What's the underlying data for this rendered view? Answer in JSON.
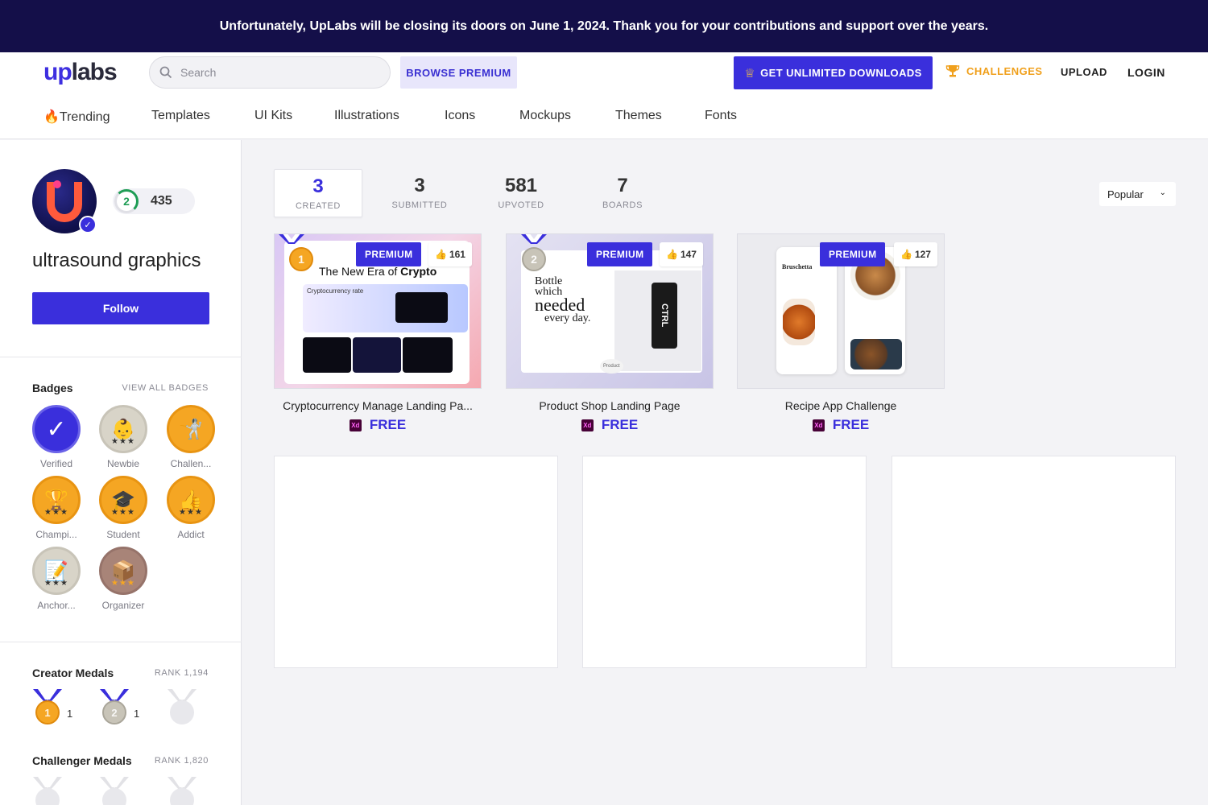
{
  "banner": {
    "text": "Unfortunately, UpLabs will be closing its doors on June 1, 2024. Thank you for your contributions and support over the years."
  },
  "header": {
    "logo_up": "up",
    "logo_labs": "labs",
    "search_placeholder": "Search",
    "browse_premium": "BROWSE PREMIUM",
    "unlimited": "GET UNLIMITED DOWNLOADS",
    "challenges": "CHALLENGES",
    "upload": "UPLOAD",
    "login": "LOGIN"
  },
  "categories": [
    "Trending",
    "Templates",
    "UI Kits",
    "Illustrations",
    "Icons",
    "Mockups",
    "Themes",
    "Fonts"
  ],
  "profile": {
    "level": "2",
    "points": "435",
    "name": "ultrasound graphics",
    "follow": "Follow"
  },
  "badges": {
    "title": "Badges",
    "view_all": "VIEW ALL BADGES",
    "items": [
      {
        "label": "Verified",
        "icon": "check-icon",
        "stars": ""
      },
      {
        "label": "Newbie",
        "icon": "baby-icon",
        "stars": "★★★"
      },
      {
        "label": "Challen...",
        "icon": "fighter-icon",
        "stars": ""
      },
      {
        "label": "Champi...",
        "icon": "trophy-icon",
        "stars": "★★★"
      },
      {
        "label": "Student",
        "icon": "graduation-cap-icon",
        "stars": "★★★"
      },
      {
        "label": "Addict",
        "icon": "thumbs-up-icon",
        "stars": "★★★"
      },
      {
        "label": "Anchor...",
        "icon": "notepad-icon",
        "stars": "★★★"
      },
      {
        "label": "Organizer",
        "icon": "box-icon",
        "stars": "★★★"
      }
    ]
  },
  "creator_medals": {
    "title": "Creator Medals",
    "rank": "RANK 1,194",
    "items": [
      {
        "number": "1",
        "count": "1"
      },
      {
        "number": "2",
        "count": "1"
      },
      {
        "number": "",
        "count": ""
      }
    ]
  },
  "challenger_medals": {
    "title": "Challenger Medals",
    "rank": "RANK 1,820"
  },
  "stats": [
    {
      "value": "3",
      "label": "CREATED"
    },
    {
      "value": "3",
      "label": "SUBMITTED"
    },
    {
      "value": "581",
      "label": "UPVOTED"
    },
    {
      "value": "7",
      "label": "BOARDS"
    }
  ],
  "sort": {
    "value": "Popular"
  },
  "cards": [
    {
      "tag": "PREMIUM",
      "likes": "161",
      "medal": "1",
      "title": "Cryptocurrency Manage Landing Pa...",
      "price": "FREE",
      "thumb_headline_a": "The New Era of ",
      "thumb_headline_b": "Crypto",
      "thumb_sub": "Cryptocurrency rate"
    },
    {
      "tag": "PREMIUM",
      "likes": "147",
      "medal": "2",
      "title": "Product Shop Landing Page",
      "price": "FREE",
      "thumb_line1": "Bottle",
      "thumb_line2": "which",
      "thumb_line3": "needed",
      "thumb_line4": "every day.",
      "thumb_ctrl": "CTRL",
      "thumb_product": "Product"
    },
    {
      "tag": "PREMIUM",
      "likes": "127",
      "title": "Recipe App Challenge",
      "price": "FREE",
      "thumb_title": "Bruschetta"
    }
  ],
  "colors": {
    "accent": "#3a2fdc",
    "banner": "#140f49",
    "gold": "#f0a01c",
    "silver": "#c8c4b8"
  }
}
